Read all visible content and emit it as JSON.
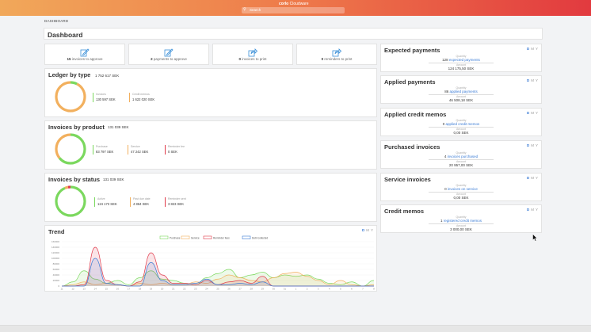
{
  "header": {
    "brand_bold": "corlo",
    "brand_rest": "Cloudware",
    "search_placeholder": "Search",
    "colors": {
      "start": "#f1a85a",
      "end": "#e23a3f"
    }
  },
  "breadcrumb": "DASHBOARD",
  "page_title": "Dashboard",
  "actions": [
    {
      "count": "15",
      "label": "invoices to approve",
      "icon": "approve-icon"
    },
    {
      "count": "2",
      "label": "payments to approve",
      "icon": "approve-icon"
    },
    {
      "count": "0",
      "label": "invoices to print",
      "icon": "print-share-icon"
    },
    {
      "count": "0",
      "label": "reminders to print",
      "icon": "print-share-icon"
    }
  ],
  "ledger": {
    "title": "Ledger by type",
    "total": "1 752 617 SEK",
    "legend": [
      {
        "name": "Invoices",
        "value": "130 597 SEK",
        "color": "#7bd85e"
      },
      {
        "name": "Credit memos",
        "value": "1 622 020 SEK",
        "color": "#f2b05e"
      }
    ],
    "ring": [
      {
        "value": 130597,
        "color": "#7bd85e"
      },
      {
        "value": 1622020,
        "color": "#f2b05e"
      }
    ]
  },
  "by_product": {
    "title": "Invoices by product",
    "total": "131 039 SEK",
    "legend": [
      {
        "name": "Purchase",
        "value": "83 797 SEK",
        "color": "#7bd85e"
      },
      {
        "name": "Service",
        "value": "47 242 SEK",
        "color": "#f2b05e"
      },
      {
        "name": "Reminder fee",
        "value": "0 SEK",
        "color": "#e0394a"
      }
    ],
    "ring": [
      {
        "value": 83797,
        "color": "#7bd85e"
      },
      {
        "value": 47242,
        "color": "#f2b05e"
      }
    ]
  },
  "by_status": {
    "title": "Invoices by status",
    "total": "131 039 SEK",
    "legend": [
      {
        "name": "Active",
        "value": "124 173 SEK",
        "color": "#7bd85e"
      },
      {
        "name": "Past due date",
        "value": "4 864 SEK",
        "color": "#f2b05e"
      },
      {
        "name": "Reminder sent",
        "value": "3 823 SEK",
        "color": "#e0394a"
      }
    ],
    "ring": [
      {
        "value": 124173,
        "color": "#7bd85e"
      },
      {
        "value": 4864,
        "color": "#f2b05e"
      },
      {
        "value": 3823,
        "color": "#e0394a"
      }
    ]
  },
  "period_toggle": {
    "d": "D",
    "m": "M",
    "y": "Y"
  },
  "panels": [
    {
      "title": "Expected payments",
      "small": "Quantity",
      "count": "128",
      "desc": "expected payments",
      "small2": "Amount",
      "amount": "124 175,50 SEK",
      "active": "D"
    },
    {
      "title": "Applied payments",
      "small": "Quantity",
      "count": "86",
      "desc": "applied payments",
      "small2": "Amount",
      "amount": "46 508,18 SEK",
      "active": "D"
    },
    {
      "title": "Applied credit memos",
      "small": "Quantity",
      "count": "0",
      "desc": "applied credit memos",
      "small2": "Amount",
      "amount": "0,00 SEK",
      "active": "D"
    },
    {
      "title": "Purchased invoices",
      "small": "Quantity",
      "count": "4",
      "desc": "invoices purchased",
      "small2": "Amount",
      "amount": "20 957,00 SEK",
      "active": "D"
    },
    {
      "title": "Service invoices",
      "small": "Quantity",
      "count": "0",
      "desc": "invoices on service",
      "small2": "Amount",
      "amount": "0,00 SEK",
      "active": "D"
    },
    {
      "title": "Credit memos",
      "small": "Quantity",
      "count": "1",
      "desc": "registered credit memos",
      "small2": "Amount",
      "amount": "3 000,00 SEK",
      "active": "D"
    }
  ],
  "chart_data": {
    "type": "area",
    "title": "Trend",
    "legend_position": "top-center",
    "ylim": [
      0,
      160000
    ],
    "yticks": [
      0,
      20000,
      40000,
      60000,
      80000,
      100000,
      120000,
      140000,
      160000
    ],
    "categories": [
      "11",
      "12",
      "13",
      "14",
      "15",
      "16",
      "17",
      "18",
      "19",
      "20",
      "21",
      "22",
      "23",
      "24",
      "25",
      "26",
      "27",
      "28",
      "29",
      "30",
      "31",
      "1",
      "2",
      "3",
      "4",
      "5",
      "6",
      "7",
      "8"
    ],
    "series": [
      {
        "name": "Purchase",
        "color": "#7bd85e",
        "values": [
          0,
          15000,
          55000,
          25000,
          10000,
          20000,
          5000,
          30000,
          55000,
          25000,
          20000,
          10000,
          5000,
          30000,
          45000,
          60000,
          30000,
          40000,
          50000,
          30000,
          40000,
          35000,
          40000,
          25000,
          10000,
          5000,
          15000,
          0,
          20000
        ]
      },
      {
        "name": "Service",
        "color": "#f2b05e",
        "values": [
          0,
          5000,
          15000,
          5000,
          10000,
          5000,
          0,
          10000,
          5000,
          10000,
          5000,
          5000,
          15000,
          10000,
          25000,
          40000,
          30000,
          20000,
          15000,
          30000,
          45000,
          50000,
          35000,
          20000,
          5000,
          20000,
          5000,
          0,
          5000
        ]
      },
      {
        "name": "Reminder fees",
        "color": "#e0394a",
        "values": [
          0,
          0,
          5000,
          140000,
          20000,
          5000,
          0,
          15000,
          120000,
          40000,
          10000,
          10000,
          5000,
          20000,
          5000,
          15000,
          20000,
          10000,
          35000,
          0,
          0,
          0,
          0,
          0,
          0,
          0,
          0,
          0,
          0
        ]
      },
      {
        "name": "Debt collected",
        "color": "#3a7bd5",
        "values": [
          0,
          0,
          0,
          100000,
          10000,
          5000,
          0,
          0,
          85000,
          20000,
          5000,
          5000,
          10000,
          25000,
          5000,
          5000,
          10000,
          5000,
          15000,
          0,
          0,
          0,
          0,
          0,
          0,
          0,
          0,
          0,
          0
        ]
      }
    ]
  }
}
